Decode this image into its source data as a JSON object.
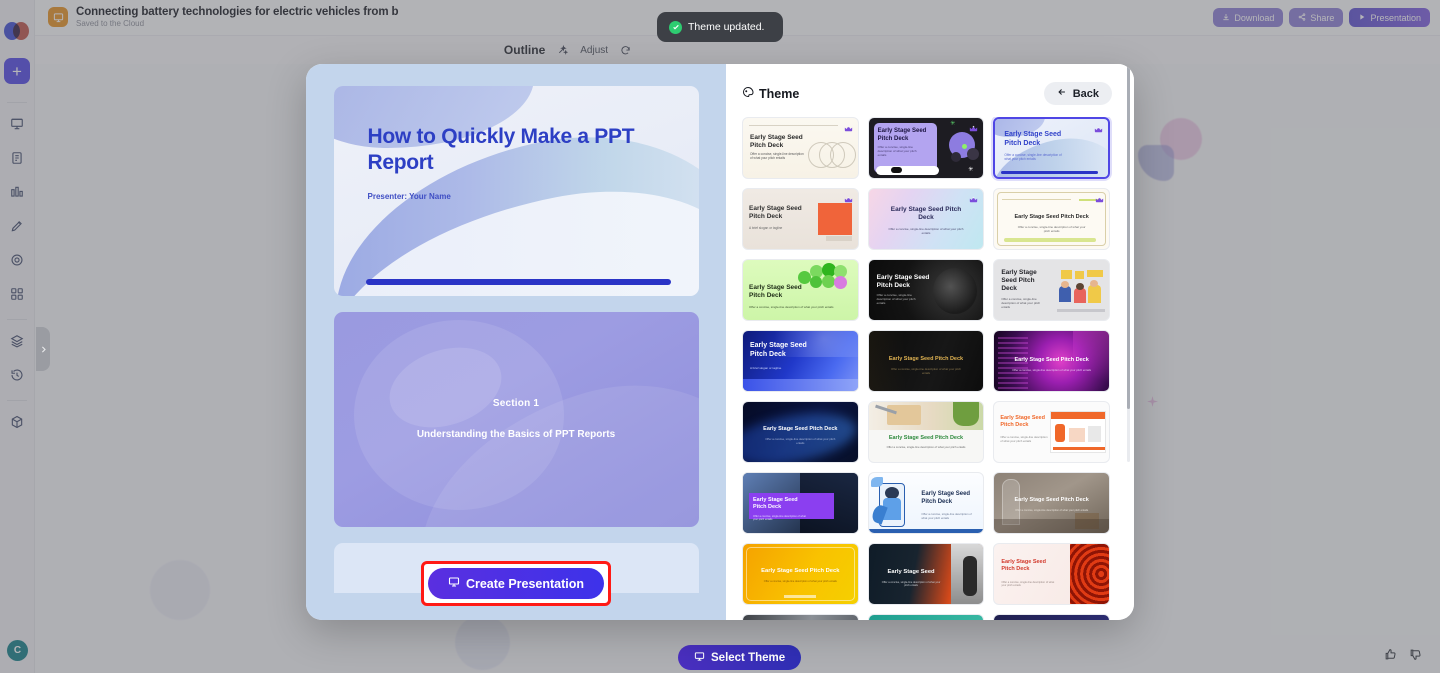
{
  "header": {
    "doc_title": "Connecting battery technologies for electric vehicles from b",
    "doc_subtitle": "Saved to the Cloud",
    "download_label": "Download",
    "share_label": "Share",
    "presentation_label": "Presentation"
  },
  "toast": {
    "message": "Theme updated."
  },
  "toolbar": {
    "outline_label": "Outline",
    "adjust_label": "Adjust"
  },
  "sidebar": {
    "add_label": "+",
    "icons": [
      "presentation-icon",
      "document-icon",
      "chart-icon",
      "edit-icon",
      "target-icon",
      "grid-icon",
      "layers-icon",
      "history-icon",
      "box-icon"
    ],
    "avatar_initial": "C"
  },
  "preview": {
    "slide1": {
      "title": "How to Quickly Make a PPT Report",
      "presenter": "Presenter: Your Name"
    },
    "slide2": {
      "section": "Section 1",
      "subtitle": "Understanding the Basics of PPT Reports"
    },
    "create_button": "Create Presentation"
  },
  "theme_panel": {
    "title": "Theme",
    "back_label": "Back",
    "cards": [
      {
        "title": "Early Stage Seed Pitch Deck",
        "desc": "Offer a concise, single-line description of what your pitch entails",
        "style": "cream",
        "premium": true,
        "selected": false
      },
      {
        "title": "Early Stage Seed Pitch Deck",
        "desc": "Offer a concise, single-line description of what your pitch entails",
        "style": "dark-purple",
        "premium": true,
        "selected": false
      },
      {
        "title": "Early Stage Seed Pitch Deck",
        "desc": "Offer a concise, single-line description of what your pitch entails",
        "style": "blue-wave",
        "premium": true,
        "selected": true
      },
      {
        "title": "Early Stage Seed Pitch Deck",
        "desc": "A brief slogan or tagline",
        "style": "beige-orange",
        "premium": true,
        "selected": false
      },
      {
        "title": "Early Stage Seed Pitch Deck",
        "desc": "Offer a concise, single-line description of what your pitch entails",
        "style": "pastel-gradient",
        "premium": true,
        "selected": false
      },
      {
        "title": "Early Stage Seed Pitch Deck",
        "desc": "Offer a concise, single-line description of what your pitch entails",
        "style": "cream-line",
        "premium": true,
        "selected": false
      },
      {
        "title": "Early Stage Seed Pitch Deck",
        "desc": "Offer a concise, single-line description of what your pitch entails",
        "style": "green-dots",
        "premium": false,
        "selected": false
      },
      {
        "title": "Early Stage Seed Pitch Deck",
        "desc": "Offer a concise, single-line description of what your pitch entails",
        "style": "black-texture",
        "premium": false,
        "selected": false
      },
      {
        "title": "Early Stage Seed Pitch Deck",
        "desc": "Offer a concise, single-line description of what your pitch entails",
        "style": "gray-illustration",
        "premium": false,
        "selected": false
      },
      {
        "title": "Early Stage Seed Pitch Deck",
        "desc": "A brief slogan or tagline",
        "style": "blue-gradient",
        "premium": false,
        "selected": false
      },
      {
        "title": "Early Stage Seed Pitch Deck",
        "desc": "Offer a concise, single-line description of what your pitch entails",
        "style": "black-gold",
        "premium": false,
        "selected": false
      },
      {
        "title": "Early Stage Seed Pitch Deck",
        "desc": "Offer a concise, single-line description of what your pitch entails",
        "style": "purple-neon",
        "premium": false,
        "selected": false
      },
      {
        "title": "Early Stage Seed Pitch Deck",
        "desc": "Offer a concise, single-line description of what your pitch entails",
        "style": "navy-wave",
        "premium": false,
        "selected": false
      },
      {
        "title": "Early Stage Seed Pitch Deck",
        "desc": "Offer a concise, single-line description of what your pitch entails",
        "style": "notebook-photo",
        "premium": false,
        "selected": false
      },
      {
        "title": "Early Stage Seed Pitch Deck",
        "desc": "Offer a concise, single-line description of what your pitch entails",
        "style": "orange-illustration",
        "premium": false,
        "selected": false
      },
      {
        "title": "Early Stage Seed Pitch Deck",
        "desc": "Offer a concise, single-line description of what your pitch entails",
        "style": "solar-purple",
        "premium": false,
        "selected": false
      },
      {
        "title": "Early Stage Seed Pitch Deck",
        "desc": "Offer a concise, single-line description of what your pitch entails",
        "style": "character-blue",
        "premium": false,
        "selected": false
      },
      {
        "title": "Early Stage Seed Pitch Deck",
        "desc": "Offer a concise, single-line description of what your pitch entails",
        "style": "interior-photo",
        "premium": false,
        "selected": false
      },
      {
        "title": "Early Stage Seed Pitch Deck",
        "desc": "Offer a concise, single-line description of what your pitch entails",
        "style": "orange-yellow",
        "premium": false,
        "selected": false
      },
      {
        "title": "Early Stage Seed",
        "desc": "Offer a concise, single-line description of what your pitch entails",
        "style": "dark-product",
        "premium": false,
        "selected": false
      },
      {
        "title": "Early Stage Seed Pitch Deck",
        "desc": "Offer a concise, single-line description of what your pitch entails",
        "style": "red-spiral",
        "premium": false,
        "selected": false
      },
      {
        "title": "",
        "desc": "",
        "style": "gray-photo",
        "premium": false,
        "selected": false
      },
      {
        "title": "",
        "desc": "",
        "style": "teal-flat",
        "premium": false,
        "selected": false
      },
      {
        "title": "",
        "desc": "",
        "style": "navy-flat",
        "premium": false,
        "selected": false
      }
    ]
  },
  "footer": {
    "select_theme_label": "Select Theme"
  }
}
